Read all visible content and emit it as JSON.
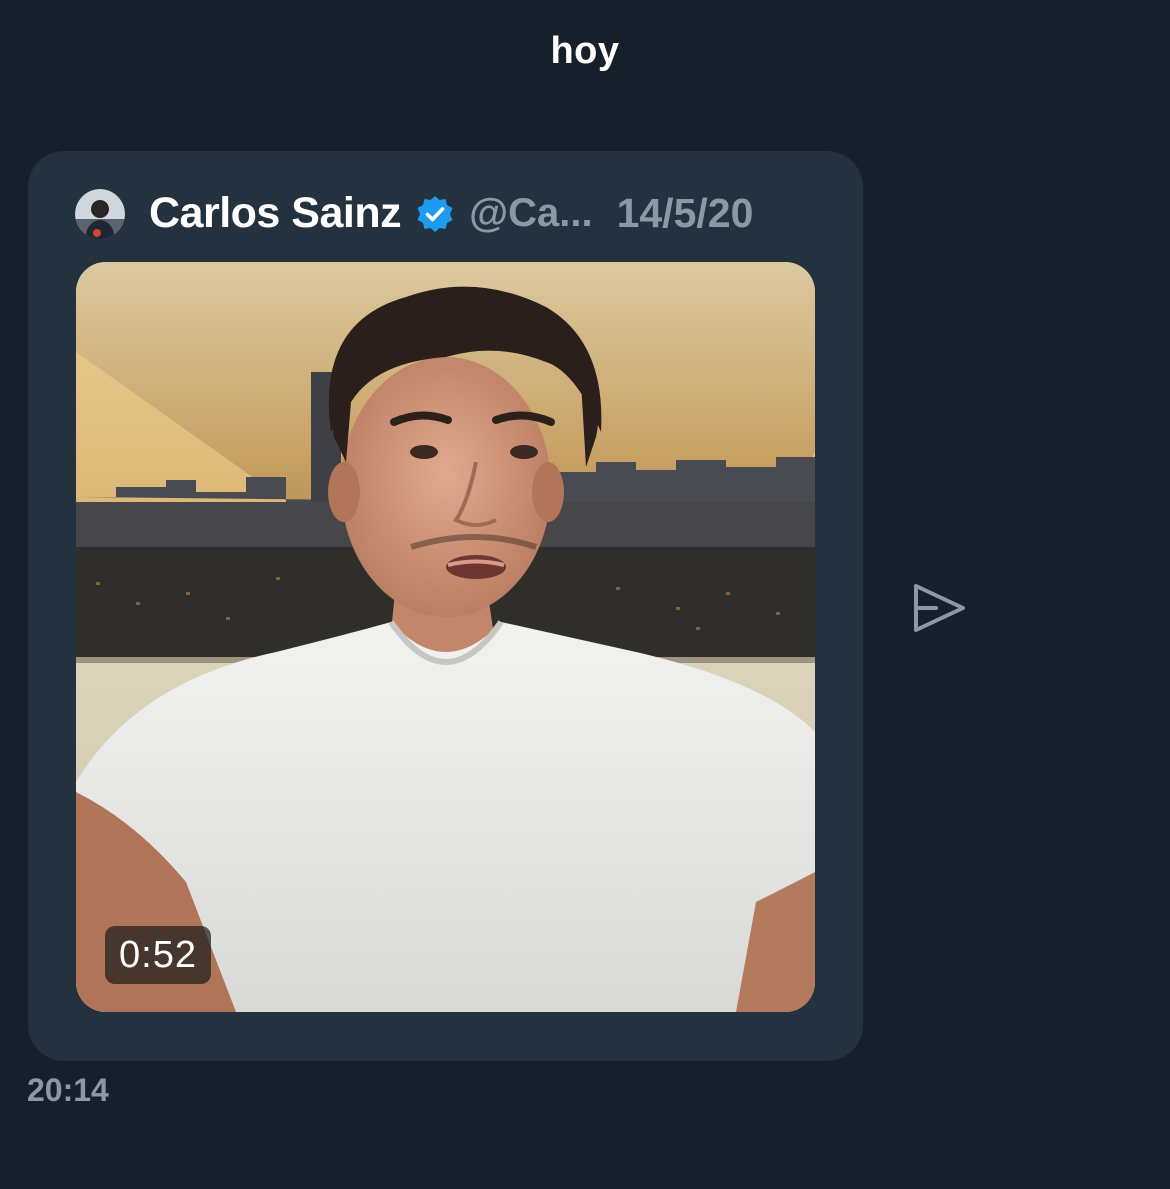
{
  "conversation": {
    "date_label": "hoy"
  },
  "message": {
    "time": "20:14",
    "tweet": {
      "author_name": "Carlos Sainz",
      "author_handle": "@Ca...",
      "verified": true,
      "date": "14/5/20",
      "media": {
        "type": "video",
        "duration": "0:52"
      }
    }
  },
  "icons": {
    "verified": "verified-badge-icon",
    "share": "send-share-icon"
  },
  "colors": {
    "background": "#16202a",
    "card": "#24313e",
    "secondary_text": "#8b98a5",
    "verified_blue": "#1d9bf0"
  }
}
